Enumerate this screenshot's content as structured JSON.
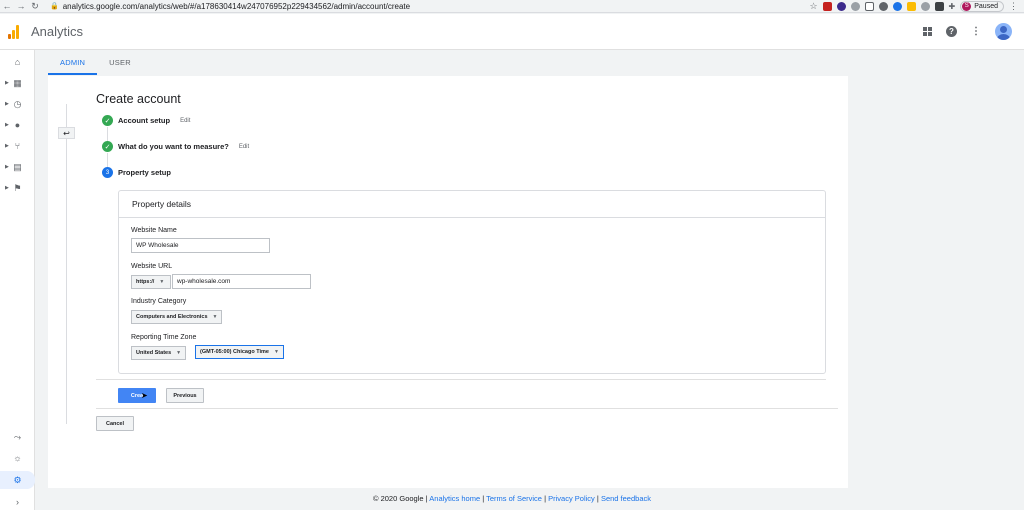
{
  "browser": {
    "url": "analytics.google.com/analytics/web/#/a178630414w247076952p229434562/admin/account/create",
    "profile_initial": "S",
    "profile_status": "Paused"
  },
  "app": {
    "title": "Analytics"
  },
  "tabs": [
    {
      "label": "ADMIN",
      "active": true
    },
    {
      "label": "USER",
      "active": false
    }
  ],
  "page": {
    "title": "Create account"
  },
  "steps": [
    {
      "label": "Account setup",
      "edit": "Edit",
      "status": "complete"
    },
    {
      "label": "What do you want to measure?",
      "edit": "Edit",
      "status": "complete"
    },
    {
      "label": "Property setup",
      "number": "3",
      "status": "current"
    }
  ],
  "property_details": {
    "heading": "Property details",
    "website_name_label": "Website Name",
    "website_name_value": "WP Wholesale",
    "website_url_label": "Website URL",
    "protocol": "https://",
    "website_url_value": "wp-wholesale.com",
    "industry_label": "Industry Category",
    "industry_value": "Computers and Electronics",
    "timezone_label": "Reporting Time Zone",
    "country_value": "United States",
    "timezone_value": "(GMT-05:00) Chicago Time"
  },
  "actions": {
    "create": "Crea",
    "previous": "Previous",
    "cancel": "Cancel"
  },
  "footer": {
    "copyright": "© 2020 Google |",
    "analytics_home": "Analytics home",
    "sep1": "|",
    "terms": "Terms of Service",
    "sep2": "|",
    "privacy": "Privacy Policy",
    "sep3": "|",
    "feedback": "Send feedback"
  }
}
